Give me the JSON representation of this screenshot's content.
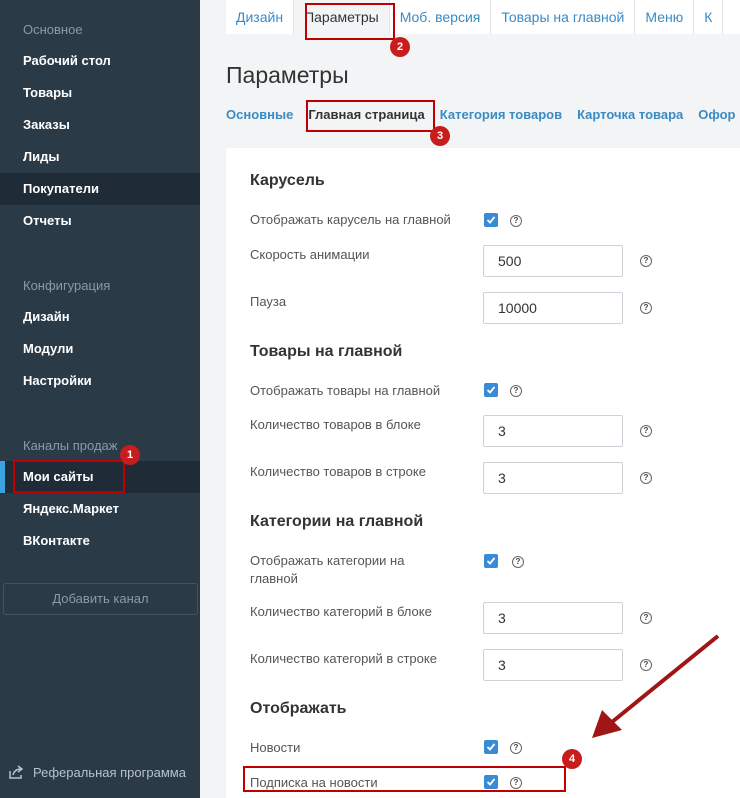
{
  "sidebar": {
    "section_main": "Основное",
    "main_items": [
      "Рабочий стол",
      "Товары",
      "Заказы",
      "Лиды",
      "Покупатели",
      "Отчеты"
    ],
    "section_config": "Конфигурация",
    "config_items": [
      "Дизайн",
      "Модули",
      "Настройки"
    ],
    "section_channels": "Каналы продаж",
    "channel_items": [
      "Мои сайты",
      "Яндекс.Маркет",
      "ВКонтакте"
    ],
    "add_channel": "Добавить канал",
    "referral": "Реферальная программа"
  },
  "top_tabs": [
    "Дизайн",
    "Параметры",
    "Моб. версия",
    "Товары на главной",
    "Меню",
    "К"
  ],
  "page_title": "Параметры",
  "sub_tabs": [
    "Основные",
    "Главная страница",
    "Категория товаров",
    "Карточка товара",
    "Офор"
  ],
  "carousel": {
    "title": "Карусель",
    "show_label": "Отображать карусель на главной",
    "speed_label": "Скорость анимации",
    "speed_value": "500",
    "pause_label": "Пауза",
    "pause_value": "10000"
  },
  "products": {
    "title": "Товары на главной",
    "show_label": "Отображать товары на главной",
    "block_label": "Количество товаров в блоке",
    "block_value": "3",
    "row_label": "Количество товаров в строке",
    "row_value": "3"
  },
  "categories": {
    "title": "Категории на главной",
    "show_label_1": "Отображать категории на",
    "show_label_2": "главной",
    "block_label": "Количество категорий в блоке",
    "block_value": "3",
    "row_label": "Количество категорий в строке",
    "row_value": "3"
  },
  "display": {
    "title": "Отображать",
    "news_label": "Новости",
    "subscribe_label": "Подписка на новости"
  },
  "help_glyph": "?",
  "badges": [
    "1",
    "2",
    "3",
    "4"
  ],
  "colors": {
    "sidebar": "#2b3a47",
    "accent": "#3a8bd6",
    "annotation": "#c00000"
  }
}
